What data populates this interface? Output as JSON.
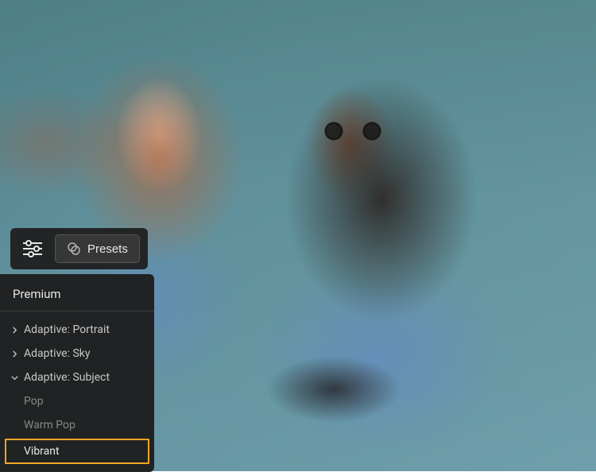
{
  "toolbar": {
    "presets_label": "Presets"
  },
  "panel": {
    "header": "Premium",
    "groups": [
      {
        "label": "Adaptive: Portrait",
        "expanded": false
      },
      {
        "label": "Adaptive: Sky",
        "expanded": false
      },
      {
        "label": "Adaptive: Subject",
        "expanded": true
      }
    ],
    "items": [
      {
        "label": "Pop",
        "selected": false
      },
      {
        "label": "Warm Pop",
        "selected": false
      },
      {
        "label": "Vibrant",
        "selected": true
      }
    ]
  },
  "colors": {
    "selection_border": "#f5a623",
    "panel_bg": "#1c1c1c",
    "text_primary": "#e8e8e8",
    "text_secondary": "#888888"
  }
}
